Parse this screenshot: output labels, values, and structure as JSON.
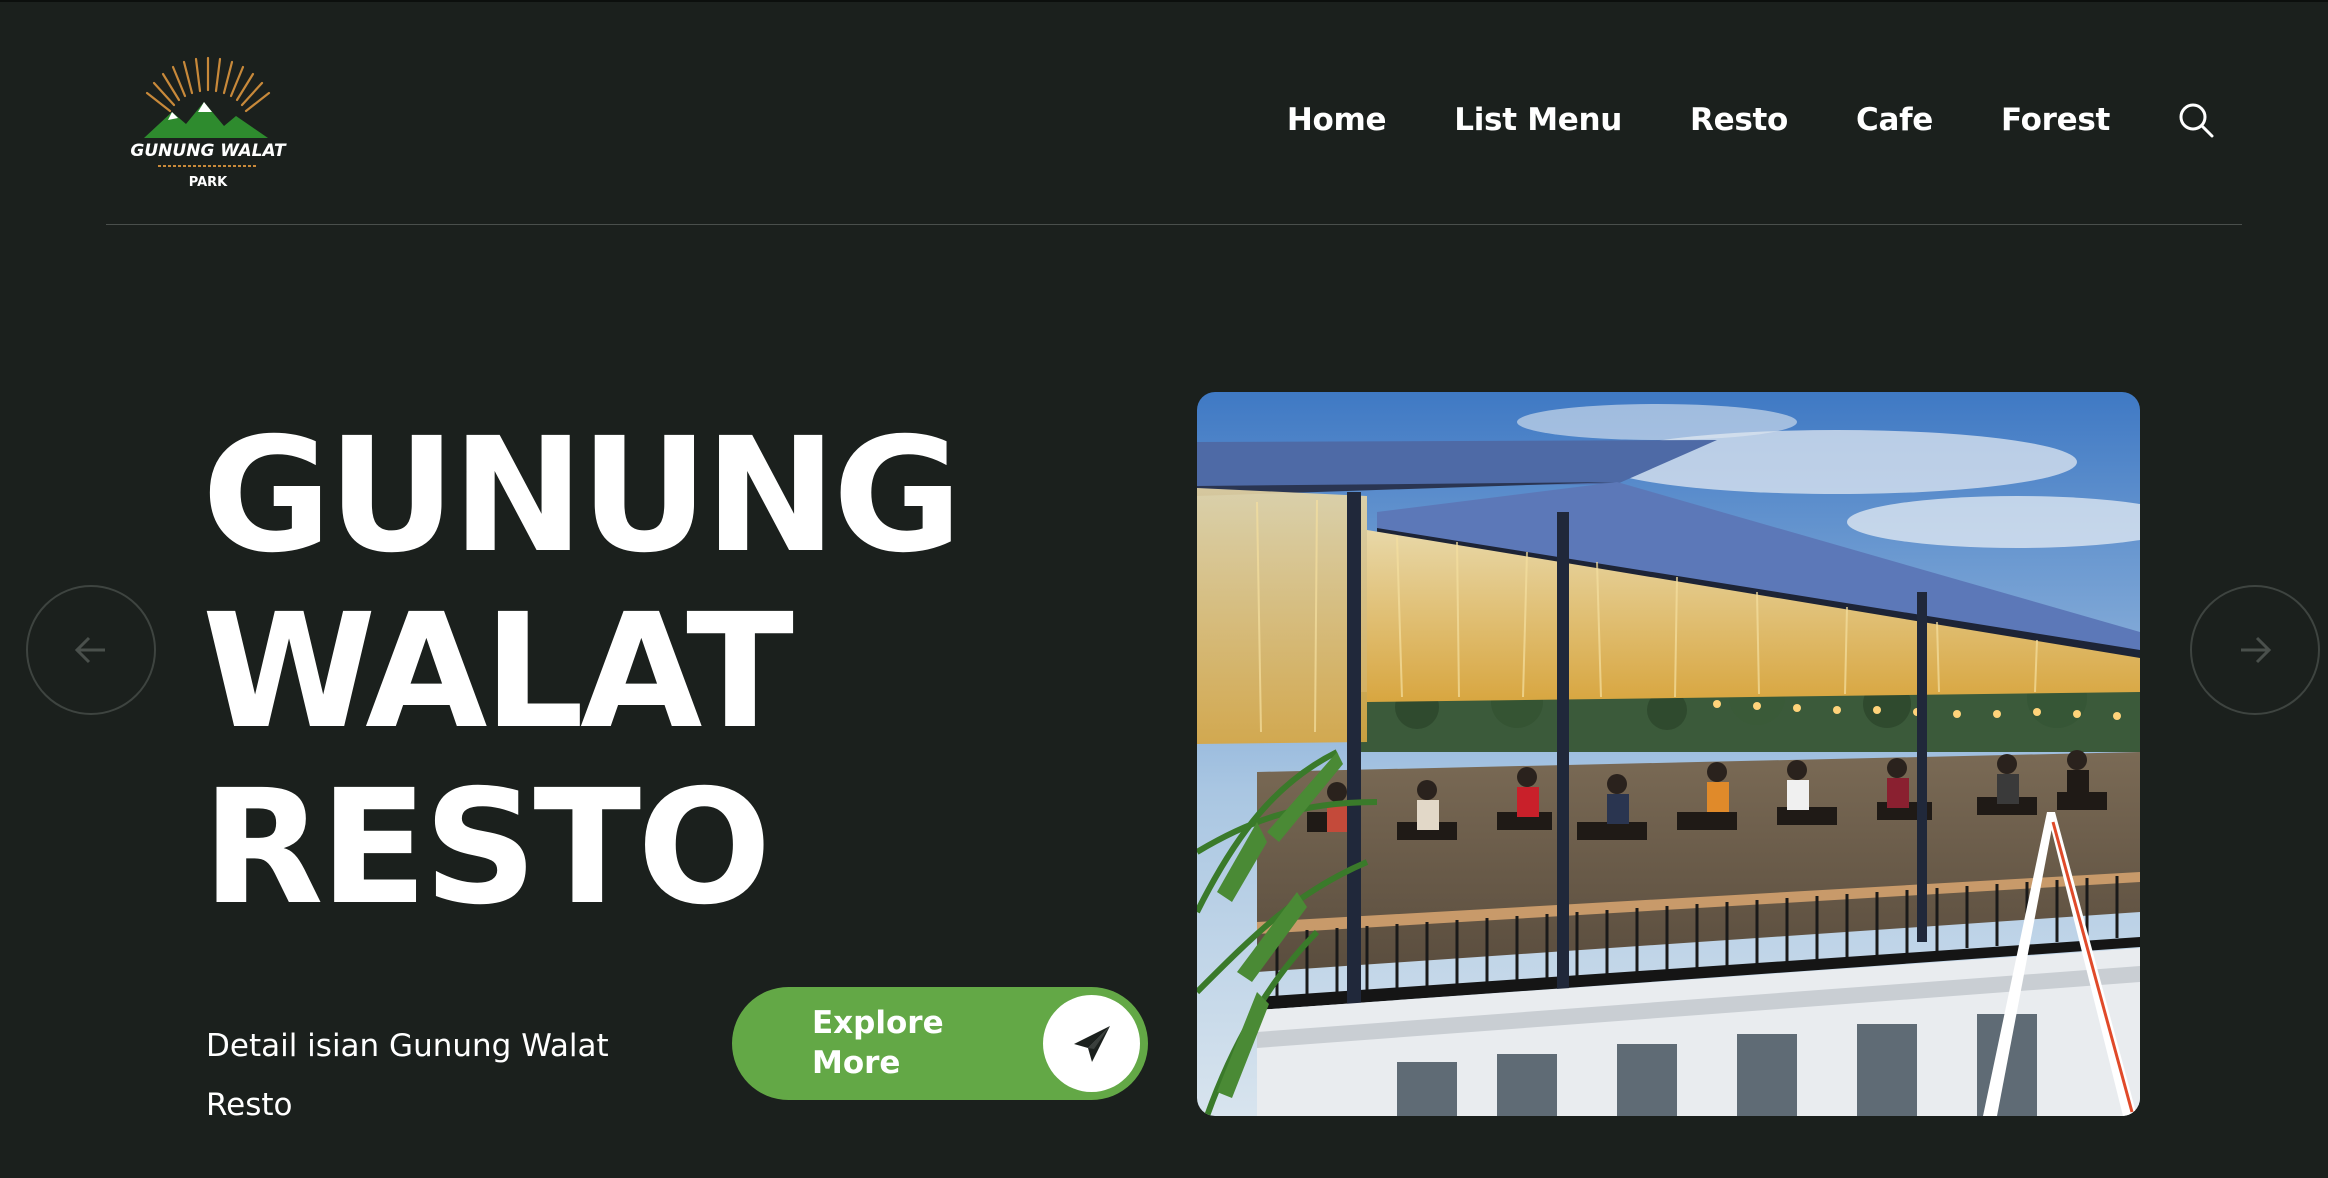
{
  "header": {
    "logo": {
      "brand": "GUNUNG WALAT",
      "sub": "PARK"
    },
    "nav": [
      {
        "label": "Home"
      },
      {
        "label": "List Menu"
      },
      {
        "label": "Resto"
      },
      {
        "label": "Cafe"
      },
      {
        "label": "Forest"
      }
    ],
    "search_icon": "search-icon"
  },
  "hero": {
    "title_lines": [
      "GUNUNG",
      "WALAT",
      "RESTO"
    ],
    "subtitle": "Detail isian Gunung Walat Resto",
    "cta": {
      "label": "Explore More",
      "icon": "paper-plane-icon"
    },
    "prev_icon": "arrow-left-icon",
    "next_icon": "arrow-right-icon"
  },
  "colors": {
    "background": "#1b201d",
    "accent": "#63a846",
    "text": "#ffffff",
    "divider": "#4a4f4c"
  }
}
